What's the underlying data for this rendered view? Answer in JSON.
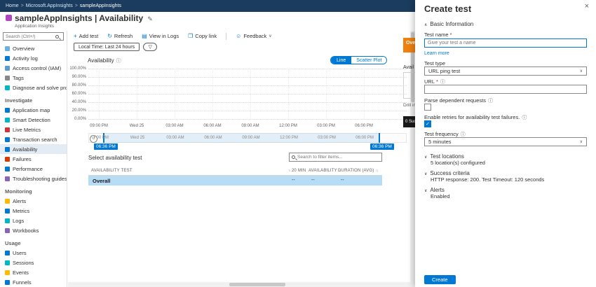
{
  "icons": {
    "add": "+",
    "refresh": "↻",
    "view_logs": "▤",
    "copy_link": "❐",
    "feedback": "☺",
    "chevron_down": "∨",
    "chevron_up": "∧",
    "info": "ⓘ",
    "close": "×",
    "edit": "✎",
    "funnel": "▽",
    "sort": "↑↓",
    "check": "✓",
    "reset": "↺",
    "breadcrumb_sep": ">"
  },
  "topbar": {
    "crumbs": [
      "Home",
      "Microsoft.AppInsights",
      "sampleAppInsights"
    ]
  },
  "header": {
    "title": "sampleAppInsights | Availability",
    "subtitle": "Application Insights"
  },
  "sidebar": {
    "search_placeholder": "Search (Ctrl+/)",
    "groups": [
      {
        "header": "",
        "items": [
          "Overview",
          "Activity log",
          "Access control (IAM)",
          "Tags",
          "Diagnose and solve problems"
        ]
      },
      {
        "header": "Investigate",
        "items": [
          "Application map",
          "Smart Detection",
          "Live Metrics",
          "Transaction search",
          "Availability",
          "Failures",
          "Performance",
          "Troubleshooting guides (previ..."
        ]
      },
      {
        "header": "Monitoring",
        "items": [
          "Alerts",
          "Metrics",
          "Logs",
          "Workbooks"
        ]
      },
      {
        "header": "Usage",
        "items": [
          "Users",
          "Sessions",
          "Events",
          "Funnels"
        ]
      }
    ]
  },
  "toolbar": {
    "add_test": "Add test",
    "refresh": "Refresh",
    "view_logs": "View in Logs",
    "copy_link": "Copy link",
    "feedback": "Feedback"
  },
  "filterbar": {
    "time_range": "Local Time: Last 24 hours"
  },
  "chart": {
    "title": "Availability",
    "toggle_line": "Line",
    "toggle_scatter": "Scatter Plot",
    "y_labels": [
      "100.00%",
      "90.00%",
      "80.00%",
      "60.00%",
      "40.00%",
      "20.00%",
      "0.00%"
    ],
    "x_labels": [
      "09:00 PM",
      "Wed 25",
      "03:00 AM",
      "06:00 AM",
      "09:00 AM",
      "12:00 PM",
      "03:00 PM",
      "06:00 PM"
    ],
    "brush_start": "06:36 PM",
    "brush_end": "06:36 PM"
  },
  "chart_data": {
    "type": "line",
    "title": "Availability",
    "x_tick_labels": [
      "09:00 PM",
      "Wed 25",
      "03:00 AM",
      "06:00 AM",
      "09:00 AM",
      "12:00 PM",
      "03:00 PM",
      "06:00 PM"
    ],
    "y_tick_labels": [
      "100.00%",
      "90.00%",
      "80.00%",
      "60.00%",
      "40.00%",
      "20.00%",
      "0.00%"
    ],
    "ylim": [
      0,
      100
    ],
    "series": [],
    "selected_range": [
      "06:36 PM",
      "06:36 PM"
    ]
  },
  "table": {
    "select_label": "Select availability test",
    "filter_placeholder": "Search to filter items...",
    "columns": [
      "AVAILABILITY TEST",
      "20 MIN",
      "AVAILABILITY",
      "DURATION (AVG)"
    ],
    "rows": [
      {
        "name": "Overall",
        "values": [
          "--",
          "--",
          "--"
        ]
      }
    ]
  },
  "fragments": {
    "tab": "Ove",
    "label": "Avail",
    "drill": "Drill into",
    "button": "0 Suc"
  },
  "create_panel": {
    "title": "Create test",
    "basic_info": "Basic Information",
    "test_name_label": "Test name",
    "required_mark": "*",
    "test_name_placeholder": "Give your test a name",
    "learn_more": "Learn more",
    "test_type_label": "Test type",
    "test_type_value": "URL ping test",
    "url_label": "URL",
    "parse_label": "Parse dependent requests",
    "retries_label": "Enable retries for availability test failures.",
    "retries_checked": true,
    "frequency_label": "Test frequency",
    "frequency_value": "5 minutes",
    "sections": [
      {
        "label": "Test locations",
        "detail": "5 location(s) configured"
      },
      {
        "label": "Success criteria",
        "detail": "HTTP response: 200. Test Timeout: 120 seconds"
      },
      {
        "label": "Alerts",
        "detail": "Enabled"
      }
    ],
    "create_button": "Create"
  }
}
